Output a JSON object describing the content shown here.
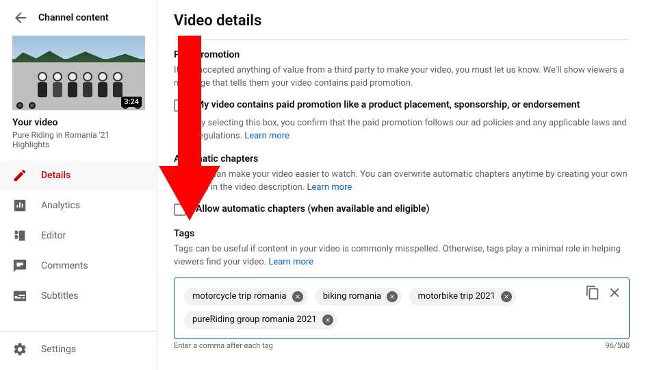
{
  "sidebar": {
    "header": "Channel content",
    "thumb_duration": "3:24",
    "your_video_label": "Your video",
    "video_title": "Pure Riding in Romania '21 Highlights",
    "items": [
      {
        "label": "Details",
        "icon": "pencil",
        "active": true
      },
      {
        "label": "Analytics",
        "icon": "analytics",
        "active": false
      },
      {
        "label": "Editor",
        "icon": "editor",
        "active": false
      },
      {
        "label": "Comments",
        "icon": "comments",
        "active": false
      },
      {
        "label": "Subtitles",
        "icon": "subtitles",
        "active": false
      }
    ],
    "settings_label": "Settings"
  },
  "main": {
    "title": "Video details",
    "paid_promotion": {
      "heading": "Paid promotion",
      "desc": "If you accepted anything of value from a third party to make your video, you must let us know. We'll show viewers a message that tells them your video contains paid promotion.",
      "checkbox_label": "My video contains paid promotion like a product placement, sponsorship, or endorsement",
      "note_prefix": "By selecting this box, you confirm that the paid promotion follows our ad policies and any applicable laws and regulations. ",
      "learn_more": "Learn more"
    },
    "auto_chapters": {
      "heading": "Automatic chapters",
      "desc_prefix": "Chapters can make your video easier to watch. You can overwrite automatic chapters anytime by creating your own chapters in the video description. ",
      "learn_more": "Learn more",
      "checkbox_label": "Allow automatic chapters (when available and eligible)"
    },
    "tags": {
      "heading": "Tags",
      "desc_prefix": "Tags can be useful if content in your video is commonly misspelled. Otherwise, tags play a minimal role in helping viewers find your video. ",
      "learn_more": "Learn more",
      "items": [
        "motorcycle trip romania",
        "biking romania",
        "motorbike trip 2021",
        "pureRiding group romania 2021"
      ],
      "helper_left": "Enter a comma after each tag",
      "counter": "96/500"
    }
  },
  "annotation": {
    "arrow_color": "#ff0000"
  }
}
